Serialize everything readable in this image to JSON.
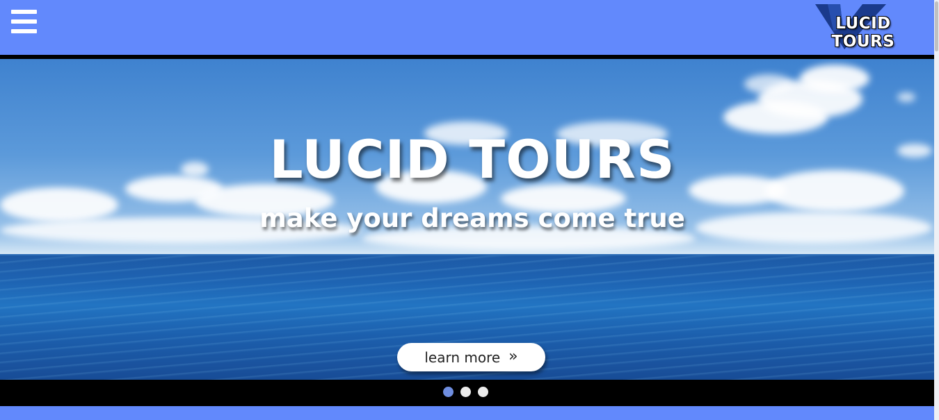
{
  "header": {
    "menu_icon": "hamburger-menu-icon",
    "logo_text": "LUCID TOURS",
    "background": "#6289fc"
  },
  "hero": {
    "title": "LUCID TOURS",
    "subtitle": "make your dreams come true",
    "cta_label": "learn more",
    "cta_arrow": "»"
  },
  "slider": {
    "dot_count": 3,
    "active_index": 0,
    "active_color": "#6f8ee0",
    "inactive_color": "#ececec"
  }
}
